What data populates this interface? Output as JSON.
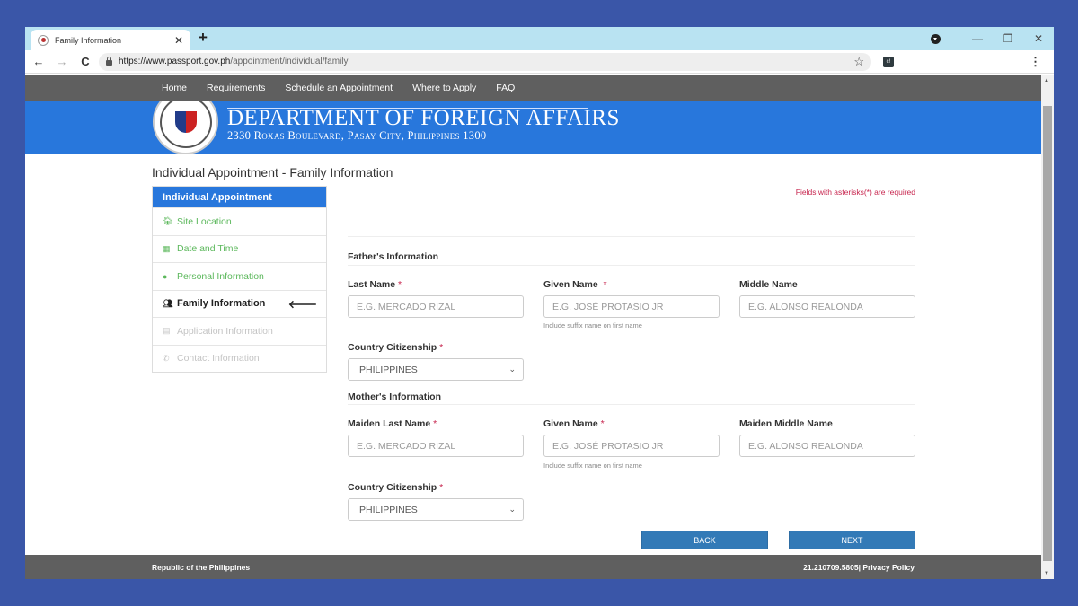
{
  "browser": {
    "tab_title": "Family Information",
    "tab_close": "✕",
    "new_tab": "+",
    "url_host": "https://www.passport.gov.ph",
    "url_path": "/appointment/individual/family",
    "ext_label": "c!",
    "controls": {
      "minimize": "—",
      "maximize": "❐",
      "close": "✕"
    }
  },
  "topnav": [
    "Home",
    "Requirements",
    "Schedule an Appointment",
    "Where to Apply",
    "FAQ"
  ],
  "banner": {
    "title": "DEPARTMENT OF FOREIGN AFFAIRS",
    "address": "2330 Roxas Boulevard, Pasay City, Philippines 1300"
  },
  "page_title": "Individual Appointment - Family Information",
  "sidebar": {
    "header": "Individual Appointment",
    "items": [
      {
        "label": "Site Location",
        "icon": "home-icon",
        "state": "done"
      },
      {
        "label": "Date and Time",
        "icon": "calendar-icon",
        "state": "done"
      },
      {
        "label": "Personal Information",
        "icon": "user-icon",
        "state": "done"
      },
      {
        "label": "Family Information",
        "icon": "users-icon",
        "state": "active"
      },
      {
        "label": "Application Information",
        "icon": "list-icon",
        "state": "disabled"
      },
      {
        "label": "Contact Information",
        "icon": "phone-icon",
        "state": "disabled"
      }
    ]
  },
  "form": {
    "required_note": "Fields with asterisks(*) are required",
    "father": {
      "section": "Father's Information",
      "last_name_label": "Last Name",
      "last_name_placeholder": "E.G. MERCADO RIZAL",
      "given_name_label": "Given Name",
      "given_name_placeholder": "E.G. JOSÉ PROTASIO JR",
      "given_name_hint": "Include suffix name on first name",
      "middle_name_label": "Middle Name",
      "middle_name_placeholder": "E.G. ALONSO REALONDA",
      "citizenship_label": "Country Citizenship",
      "citizenship_value": "PHILIPPINES"
    },
    "mother": {
      "section": "Mother's Information",
      "last_name_label": "Maiden Last Name",
      "last_name_placeholder": "E.G. MERCADO RIZAL",
      "given_name_label": "Given Name",
      "given_name_placeholder": "E.G. JOSÉ PROTASIO JR",
      "given_name_hint": "Include suffix name on first name",
      "middle_name_label": "Maiden Middle Name",
      "middle_name_placeholder": "E.G. ALONSO REALONDA",
      "citizenship_label": "Country Citizenship",
      "citizenship_value": "PHILIPPINES"
    },
    "asterisk": "*",
    "back_label": "BACK",
    "next_label": "NEXT"
  },
  "footer": {
    "left": "Republic of the Philippines",
    "right": "21.210709.5805| Privacy Policy"
  }
}
